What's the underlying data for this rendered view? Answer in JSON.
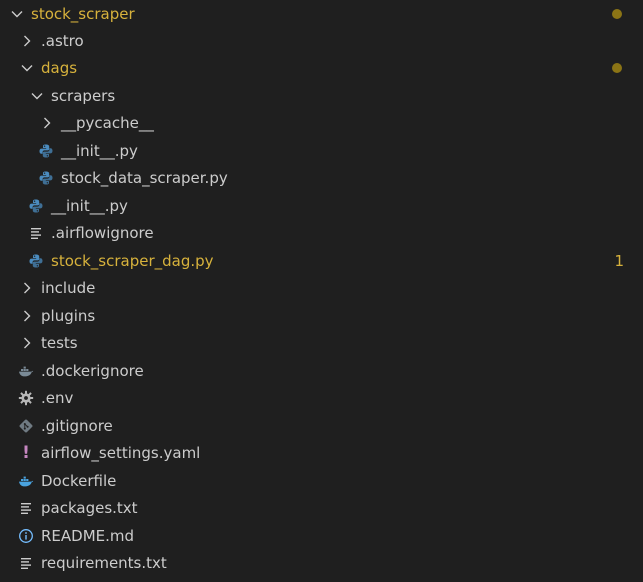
{
  "explorer": {
    "colors": {
      "background": "#1f1f1f",
      "text": "#cccccc",
      "modified": "#d7b23c",
      "modified_dot": "#8b7415",
      "python_blue": "#4b8bbe",
      "python_yellow": "#ffd43b",
      "docker_blue": "#4aa3df",
      "yaml_purple": "#c586c0",
      "info_blue": "#75beff"
    },
    "items": [
      {
        "label": "stock_scraper",
        "kind": "folder",
        "expanded": true,
        "indicator": "modified-dot"
      },
      {
        "label": ".astro",
        "kind": "folder",
        "expanded": false
      },
      {
        "label": "dags",
        "kind": "folder",
        "expanded": true,
        "indicator": "modified-dot"
      },
      {
        "label": "scrapers",
        "kind": "folder",
        "expanded": true
      },
      {
        "label": "__pycache__",
        "kind": "folder",
        "expanded": false
      },
      {
        "label": "__init__.py",
        "kind": "file",
        "icon": "python-icon"
      },
      {
        "label": "stock_data_scraper.py",
        "kind": "file",
        "icon": "python-icon"
      },
      {
        "label": "__init__.py",
        "kind": "file",
        "icon": "python-icon"
      },
      {
        "label": ".airflowignore",
        "kind": "file",
        "icon": "lines-icon"
      },
      {
        "label": "stock_scraper_dag.py",
        "kind": "file",
        "icon": "python-icon",
        "badge": "1"
      },
      {
        "label": "include",
        "kind": "folder",
        "expanded": false
      },
      {
        "label": "plugins",
        "kind": "folder",
        "expanded": false
      },
      {
        "label": "tests",
        "kind": "folder",
        "expanded": false
      },
      {
        "label": ".dockerignore",
        "kind": "file",
        "icon": "docker-icon"
      },
      {
        "label": ".env",
        "kind": "file",
        "icon": "gear-icon"
      },
      {
        "label": ".gitignore",
        "kind": "file",
        "icon": "git-icon"
      },
      {
        "label": "airflow_settings.yaml",
        "kind": "file",
        "icon": "yaml-icon",
        "glyph": "!"
      },
      {
        "label": "Dockerfile",
        "kind": "file",
        "icon": "docker-icon"
      },
      {
        "label": "packages.txt",
        "kind": "file",
        "icon": "lines-icon"
      },
      {
        "label": "README.md",
        "kind": "file",
        "icon": "info-icon"
      },
      {
        "label": "requirements.txt",
        "kind": "file",
        "icon": "lines-icon"
      }
    ]
  }
}
